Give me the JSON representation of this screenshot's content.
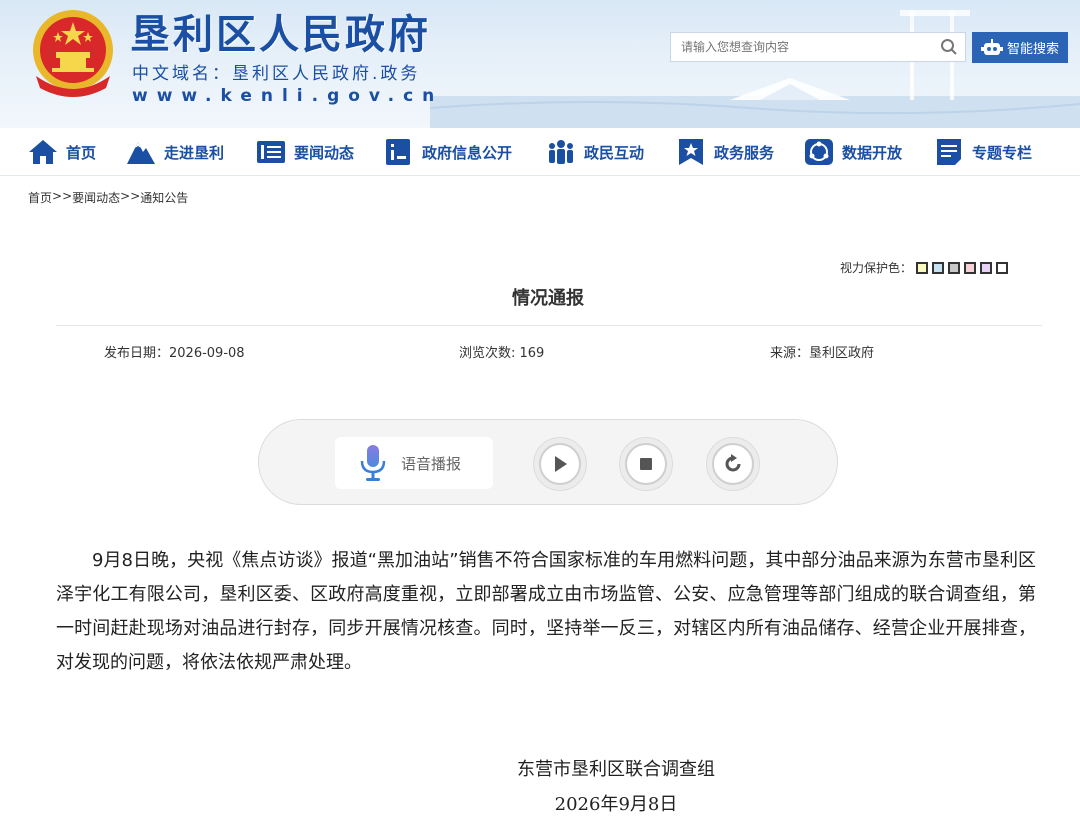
{
  "header": {
    "site_title": "垦利区人民政府",
    "domain_cn": "中文域名：垦利区人民政府.政务",
    "domain_en": "www.kenli.gov.cn",
    "search_placeholder": "请输入您想查询内容",
    "smart_search_label": "智能搜索"
  },
  "nav": {
    "items": [
      {
        "label": "首页",
        "icon": "home-icon"
      },
      {
        "label": "走进垦利",
        "icon": "mountain-icon"
      },
      {
        "label": "要闻动态",
        "icon": "news-icon"
      },
      {
        "label": "政府信息公开",
        "icon": "info-icon"
      },
      {
        "label": "政民互动",
        "icon": "people-icon"
      },
      {
        "label": "政务服务",
        "icon": "star-badge-icon"
      },
      {
        "label": "数据开放",
        "icon": "data-icon"
      },
      {
        "label": "专题专栏",
        "icon": "document-icon"
      }
    ]
  },
  "breadcrumb": {
    "items": [
      "首页",
      "要闻动态",
      "通知公告"
    ],
    "separator": ">>"
  },
  "eye_protection": {
    "label": "视力保护色：",
    "colors": [
      "#fafac0",
      "#c4e2f0",
      "#c8c8c8",
      "#f6d2d8",
      "#e6d2f5",
      "#ffffff"
    ]
  },
  "article": {
    "title": "情况通报",
    "publish_date": "发布日期：2026-09-08",
    "views": "浏览次数: 169",
    "source": "来源：垦利区政府",
    "body": "9月8日晚，央视《焦点访谈》报道“黑加油站”销售不符合国家标准的车用燃料问题，其中部分油品来源为东营市垦利区泽宇化工有限公司，垦利区委、区政府高度重视，立即部署成立由市场监管、公安、应急管理等部门组成的联合调查组，第一时间赶赴现场对油品进行封存，同步开展情况核查。同时，坚持举一反三，对辖区内所有油品储存、经营企业开展排查，对发现的问题，将依法依规严肃处理。",
    "signature_org": "东营市垦利区联合调查组",
    "signature_date": "2026年9月8日"
  },
  "player": {
    "label": "语音播报"
  }
}
